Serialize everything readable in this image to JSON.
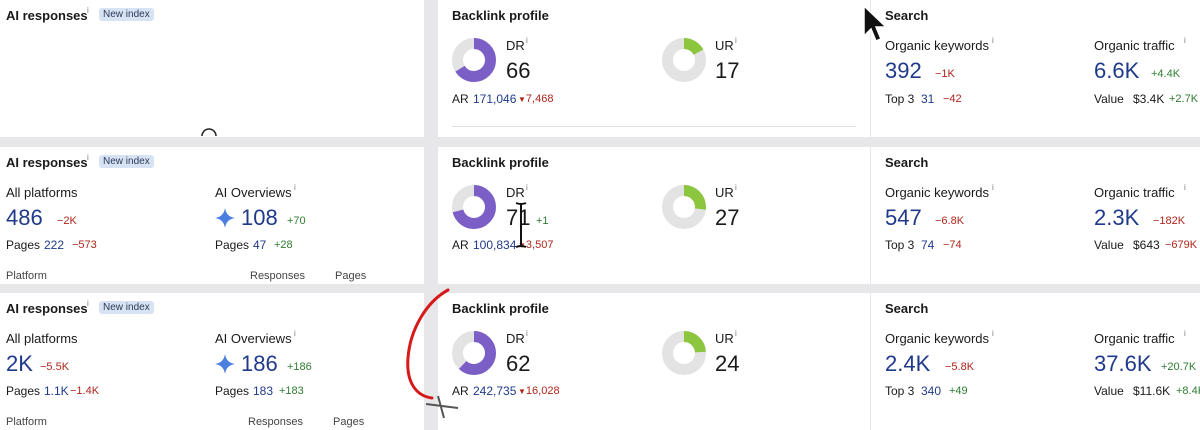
{
  "colors": {
    "primary_blue": "#1f3a8a",
    "negative_red": "#b0251b",
    "positive_green": "#2e7d32",
    "dr_purple": "#7b5ec6",
    "ur_green": "#8cc63f",
    "donut_bg": "#e3e3e3"
  },
  "rows": [
    {
      "ai": {
        "title": "AI responses",
        "badge": "New index"
      },
      "backlink": {
        "title": "Backlink profile",
        "dr_label": "DR",
        "dr_value": "66",
        "dr_ratio": 0.66,
        "ur_label": "UR",
        "ur_value": "17",
        "ur_ratio": 0.17,
        "ar_label": "AR",
        "ar_value": "171,046",
        "ar_delta": "7,468"
      },
      "search": {
        "title": "Search",
        "kw_label": "Organic keywords",
        "kw_value": "392",
        "kw_delta": "−1K",
        "top3_label": "Top 3",
        "top3_value": "31",
        "top3_delta": "−42",
        "traffic_label": "Organic traffic",
        "traffic_value": "6.6K",
        "traffic_delta": "+4.4K",
        "value_label": "Value",
        "value_value": "$3.4K",
        "value_delta": "+2.7K"
      }
    },
    {
      "ai": {
        "title": "AI responses",
        "badge": "New index",
        "platforms_label": "All platforms",
        "platforms_value": "486",
        "platforms_delta": "−2K",
        "pages_label": "Pages",
        "pages_value": "222",
        "pages_delta": "−573",
        "overviews_label": "AI Overviews",
        "overviews_value": "108",
        "overviews_delta": "+70",
        "ov_pages_label": "Pages",
        "ov_pages_value": "47",
        "ov_pages_delta": "+28",
        "col_platform": "Platform",
        "col_responses": "Responses",
        "col_pages": "Pages"
      },
      "backlink": {
        "title": "Backlink profile",
        "dr_label": "DR",
        "dr_value": "71",
        "dr_delta": "+1",
        "dr_ratio": 0.71,
        "ur_label": "UR",
        "ur_value": "27",
        "ur_ratio": 0.27,
        "ar_label": "AR",
        "ar_value": "100,834",
        "ar_delta": "3,507"
      },
      "search": {
        "title": "Search",
        "kw_label": "Organic keywords",
        "kw_value": "547",
        "kw_delta": "−6.8K",
        "top3_label": "Top 3",
        "top3_value": "74",
        "top3_delta": "−74",
        "traffic_label": "Organic traffic",
        "traffic_value": "2.3K",
        "traffic_delta": "−182K",
        "value_label": "Value",
        "value_value": "$643",
        "value_delta": "−679K"
      }
    },
    {
      "ai": {
        "title": "AI responses",
        "badge": "New index",
        "platforms_label": "All platforms",
        "platforms_value": "2K",
        "platforms_delta": "−5.5K",
        "pages_label": "Pages",
        "pages_value": "1.1K",
        "pages_delta": "−1.4K",
        "overviews_label": "AI Overviews",
        "overviews_value": "186",
        "overviews_delta": "+186",
        "ov_pages_label": "Pages",
        "ov_pages_value": "183",
        "ov_pages_delta": "+183",
        "col_platform": "Platform",
        "col_responses": "Responses",
        "col_pages": "Pages"
      },
      "backlink": {
        "title": "Backlink profile",
        "dr_label": "DR",
        "dr_value": "62",
        "dr_ratio": 0.62,
        "ur_label": "UR",
        "ur_value": "24",
        "ur_ratio": 0.24,
        "ar_label": "AR",
        "ar_value": "242,735",
        "ar_delta": "16,028"
      },
      "search": {
        "title": "Search",
        "kw_label": "Organic keywords",
        "kw_value": "2.4K",
        "kw_delta": "−5.8K",
        "top3_label": "Top 3",
        "top3_value": "340",
        "top3_delta": "+49",
        "traffic_label": "Organic traffic",
        "traffic_value": "37.6K",
        "traffic_delta": "+20.7K",
        "value_label": "Value",
        "value_value": "$11.6K",
        "value_delta": "+8.4K"
      }
    }
  ]
}
